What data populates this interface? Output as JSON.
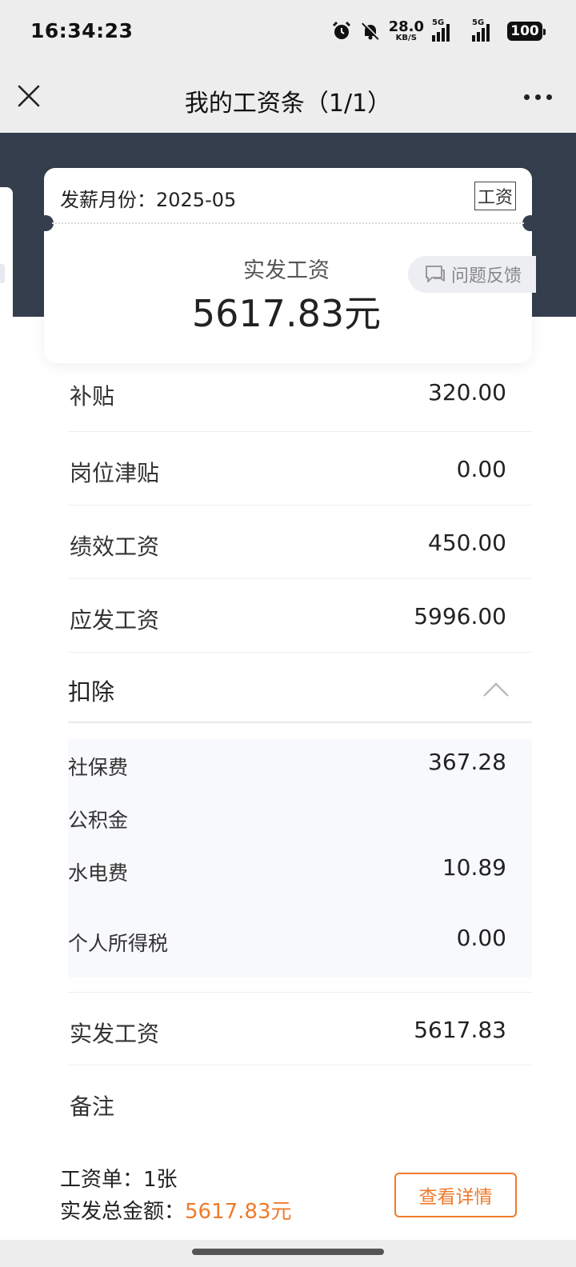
{
  "status_bar": {
    "time": "16:34:23",
    "net_speed": "28.0",
    "net_unit": "KB/S",
    "sim1": "5G",
    "sim2": "5G",
    "battery": "100",
    "icons": [
      "alarm-icon",
      "bell-off-icon",
      "signal-icon",
      "battery-icon"
    ]
  },
  "nav": {
    "title": "我的工资条（1/1）",
    "close_icon": "close-icon",
    "more_icon": "more-icon"
  },
  "card": {
    "month_label": "发薪月份：2025-05",
    "type_badge": "工资",
    "net_label": "实发工资",
    "net_amount": "5617.83元"
  },
  "feedback": {
    "label": "问题反馈",
    "icon": "chat-icon"
  },
  "partial_row": {
    "label": "补贴",
    "value": "320.00"
  },
  "items": [
    {
      "label": "岗位津贴",
      "value": "0.00"
    },
    {
      "label": "绩效工资",
      "value": "450.00"
    },
    {
      "label": "应发工资",
      "value": "5996.00"
    }
  ],
  "deduction_section": {
    "title": "扣除",
    "expanded": true,
    "rows": [
      {
        "label": "社保费",
        "value": "367.28"
      },
      {
        "label": "公积金",
        "value": ""
      },
      {
        "label": "水电费",
        "value": "10.89"
      },
      {
        "label": "个人所得税",
        "value": "0.00"
      }
    ]
  },
  "bottom_items": [
    {
      "label": "实发工资",
      "value": "5617.83"
    },
    {
      "label": "备注",
      "value": ""
    }
  ],
  "footer": {
    "count_label": "工资单：1张",
    "total_label": "实发总金额：",
    "total_amount": "5617.83元",
    "detail_button": "查看详情"
  },
  "colors": {
    "accent": "#f07a2a",
    "banner": "#353e4d",
    "background": "#ededed"
  }
}
